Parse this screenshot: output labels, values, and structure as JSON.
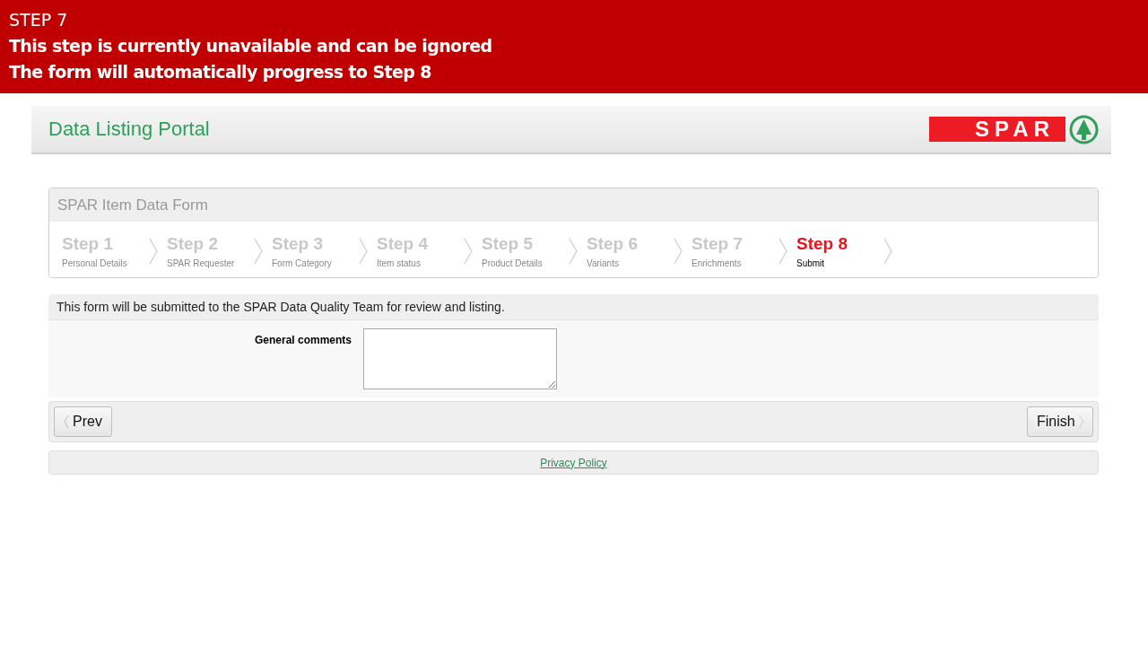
{
  "banner": {
    "title": "STEP 7",
    "lines": [
      "This step is currently unavailable and can be ignored",
      "The form will automatically progress to Step 8"
    ]
  },
  "header": {
    "title": "Data Listing Portal",
    "logo_text": "SPAR"
  },
  "form": {
    "title": "SPAR Item Data Form",
    "steps": [
      {
        "label": "Step 1",
        "sub": "Personal Details",
        "selected": false
      },
      {
        "label": "Step 2",
        "sub": "SPAR Requester",
        "selected": false
      },
      {
        "label": "Step 3",
        "sub": "Form Category",
        "selected": false
      },
      {
        "label": "Step 4",
        "sub": "Item status",
        "selected": false
      },
      {
        "label": "Step 5",
        "sub": "Product Details",
        "selected": false
      },
      {
        "label": "Step 6",
        "sub": "Variants",
        "selected": false
      },
      {
        "label": "Step 7",
        "sub": "Enrichments",
        "selected": false
      },
      {
        "label": "Step 8",
        "sub": "Submit",
        "selected": true
      }
    ]
  },
  "notice": "This form will be submitted to the SPAR Data Quality Team for review and listing.",
  "fields": [
    {
      "label": "General comments"
    }
  ],
  "buttons": {
    "prev": "Prev",
    "finish": "Finish"
  },
  "footer": {
    "link": "Privacy Policy"
  }
}
